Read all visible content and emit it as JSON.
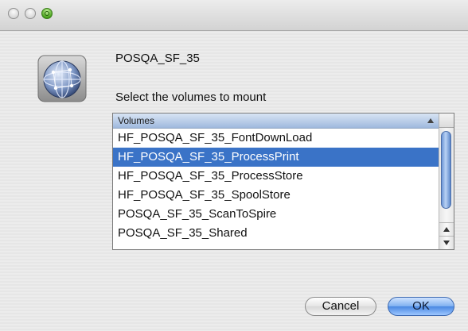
{
  "window": {
    "traffic_lights": [
      "close",
      "minimize",
      "zoom"
    ]
  },
  "icon": "network-server-globe-icon",
  "server_name": "POSQA_SF_35",
  "prompt": "Select the volumes to mount",
  "list": {
    "column_header": "Volumes",
    "sort_direction": "ascending",
    "items": [
      {
        "label": "HF_POSQA_SF_35_FontDownLoad",
        "selected": false
      },
      {
        "label": "HF_POSQA_SF_35_ProcessPrint",
        "selected": true
      },
      {
        "label": "HF_POSQA_SF_35_ProcessStore",
        "selected": false
      },
      {
        "label": "HF_POSQA_SF_35_SpoolStore",
        "selected": false
      },
      {
        "label": "POSQA_SF_35_ScanToSpire",
        "selected": false
      },
      {
        "label": "POSQA_SF_35_Shared",
        "selected": false
      }
    ]
  },
  "buttons": {
    "cancel": "Cancel",
    "ok": "OK"
  },
  "colors": {
    "selection": "#3a73c7",
    "default_button": "#4a88e2"
  }
}
